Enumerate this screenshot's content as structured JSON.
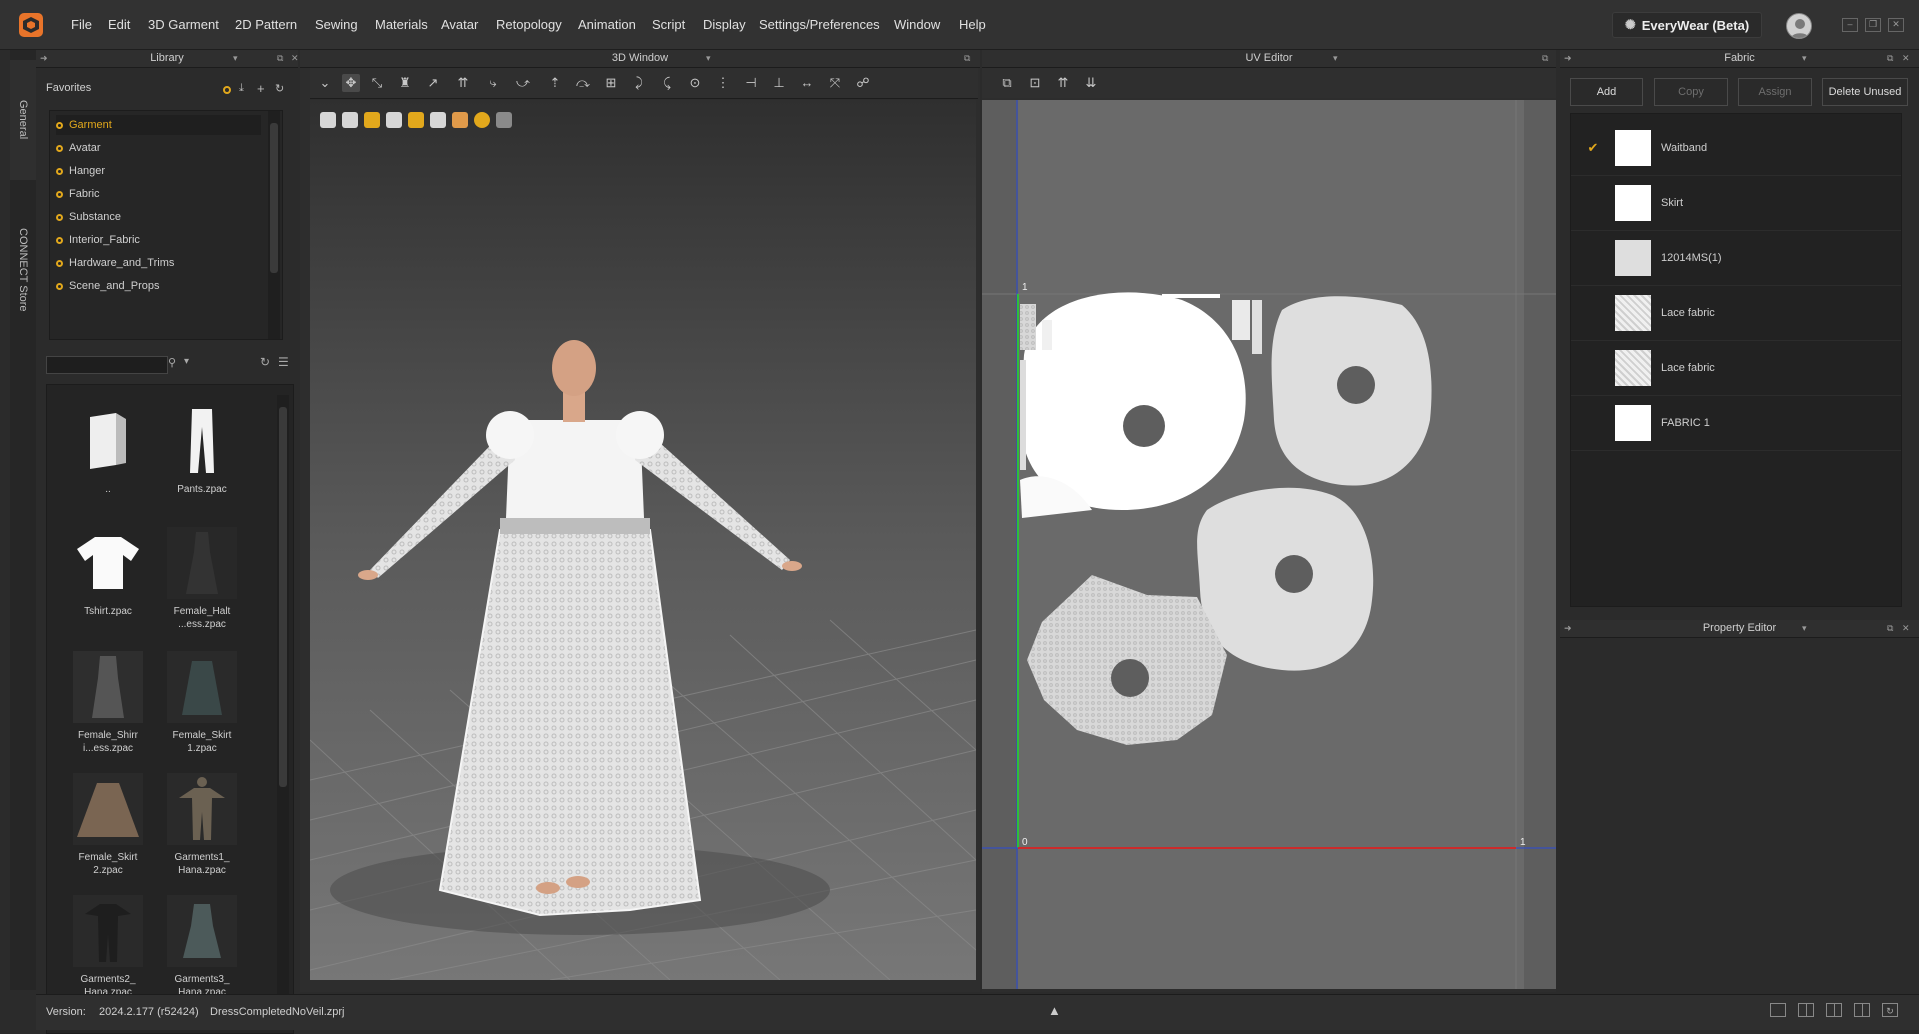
{
  "menu": {
    "items": [
      "File",
      "Edit",
      "3D Garment",
      "2D Pattern",
      "Sewing",
      "Materials",
      "Avatar",
      "Retopology",
      "Animation",
      "Script",
      "Display",
      "Settings/Preferences",
      "Window",
      "Help"
    ],
    "brand": "EveryWear (Beta)"
  },
  "side_tabs": [
    "General",
    "CONNECT Store"
  ],
  "library": {
    "title": "Library",
    "favorites_label": "Favorites",
    "favorites": [
      "Garment",
      "Avatar",
      "Hanger",
      "Fabric",
      "Substance",
      "Interior_Fabric",
      "Hardware_and_Trims",
      "Scene_and_Props"
    ],
    "search_value": "",
    "files": [
      {
        "label": "..",
        "icon": "folder-icon"
      },
      {
        "label": "Pants.zpac",
        "icon": "pants-icon"
      },
      {
        "label": "Tshirt.zpac",
        "icon": "tshirt-icon"
      },
      {
        "label": "Female_Halt\n...ess.zpac",
        "icon": "dress-icon"
      },
      {
        "label": "Female_Shirr\ni...ess.zpac",
        "icon": "dress-icon"
      },
      {
        "label": "Female_Skirt\n1.zpac",
        "icon": "skirt-icon"
      },
      {
        "label": "Female_Skirt\n2.zpac",
        "icon": "skirt-icon"
      },
      {
        "label": "Garments1_\nHana.zpac",
        "icon": "garment-icon"
      },
      {
        "label": "Garments2_\nHana.zpac",
        "icon": "garment-icon"
      },
      {
        "label": "Garments3_\nHana.zpac",
        "icon": "garment-icon"
      }
    ]
  },
  "window3d": {
    "title": "3D Window"
  },
  "uv_editor": {
    "title": "UV Editor",
    "axis_labels": {
      "origin": "0",
      "u_one": "1",
      "v_one": "1"
    }
  },
  "fabric": {
    "title": "Fabric",
    "buttons": {
      "add": "Add",
      "copy": "Copy",
      "assign": "Assign",
      "delete_unused": "Delete Unused"
    },
    "items": [
      {
        "name": "Waitband",
        "checked": true,
        "swatch": "#ffffff"
      },
      {
        "name": "Skirt",
        "checked": false,
        "swatch": "#ffffff"
      },
      {
        "name": "12014MS(1)",
        "checked": false,
        "swatch": "#dedede"
      },
      {
        "name": "Lace fabric",
        "checked": false,
        "swatch": "#e8e8e8"
      },
      {
        "name": "Lace fabric",
        "checked": false,
        "swatch": "#e8e8e8"
      },
      {
        "name": "FABRIC 1",
        "checked": false,
        "swatch": "#ffffff"
      }
    ]
  },
  "property_editor": {
    "title": "Property Editor"
  },
  "status": {
    "version_label": "Version:",
    "version": "2024.2.177 (r52424)",
    "file": "DressCompletedNoVeil.zprj"
  },
  "colors": {
    "accent": "#e2a81c",
    "bg": "#2b2b2b",
    "uv_bg": "#5e5e5e",
    "u_axis": "#cc2b2b",
    "v_axis": "#2fbf3a"
  }
}
